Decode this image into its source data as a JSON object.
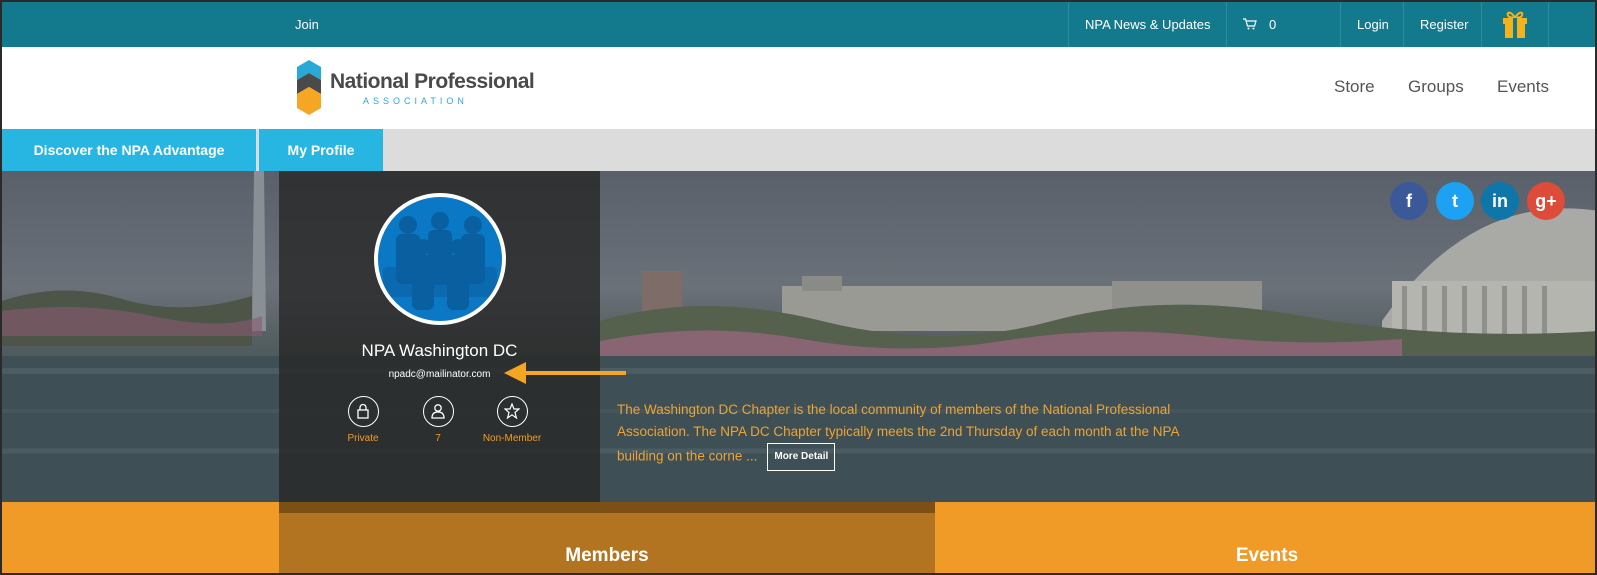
{
  "topbar": {
    "join": "Join",
    "news": "NPA News & Updates",
    "cart": "0 Items",
    "login": "Login",
    "register": "Register"
  },
  "logo": {
    "name": "National Professional",
    "tagline": "ASSOCIATION"
  },
  "nav": {
    "store": "Store",
    "groups": "Groups",
    "events": "Events"
  },
  "tabs": {
    "discover": "Discover the NPA Advantage",
    "profile": "My Profile"
  },
  "group": {
    "name": "NPA Washington DC",
    "email": "npadc@mailinator.com",
    "stats": {
      "privacy": "Private",
      "count": "7",
      "membership": "Non-Member"
    },
    "description": "The Washington DC Chapter is the local community of members of the National Professional Association. The NPA DC Chapter typically meets the 2nd Thursday of each month at the NPA building on the corne ...",
    "more_button": "More Detail"
  },
  "social": {
    "facebook": "f",
    "twitter": "t",
    "linkedin": "in",
    "googleplus": "g+"
  },
  "bottom_tabs": {
    "members": "Members",
    "events": "Events"
  },
  "colors": {
    "topbar": "#13798d",
    "tab": "#27b6e2",
    "accent_orange": "#f09a27",
    "members_tab": "#b27420",
    "avatar_blue": "#0b78c6"
  }
}
